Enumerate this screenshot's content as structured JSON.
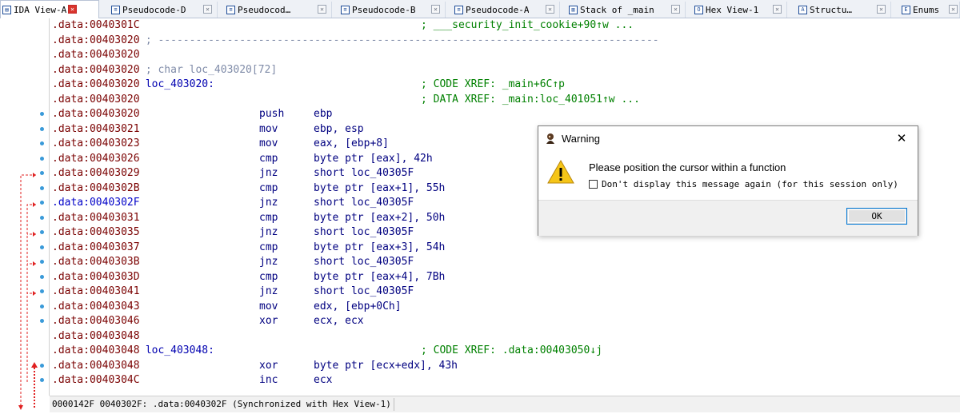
{
  "tabs": [
    {
      "label": "IDA View-A",
      "icon": "ida-view-icon",
      "active": true
    },
    {
      "label": "Pseudocode-D",
      "icon": "pseudocode-icon"
    },
    {
      "label": "Pseudocod…",
      "icon": "pseudocode-icon"
    },
    {
      "label": "Pseudocode-B",
      "icon": "pseudocode-icon"
    },
    {
      "label": "Pseudocode-A",
      "icon": "pseudocode-icon"
    },
    {
      "label": "Stack of _main",
      "icon": "stack-icon"
    },
    {
      "label": "Hex View-1",
      "icon": "hex-view-icon"
    },
    {
      "label": "Structu…",
      "icon": "structures-icon"
    },
    {
      "label": "Enums",
      "icon": "enums-icon"
    }
  ],
  "listing": [
    {
      "addr": ".data:0040301C",
      "xref": "; ___security_init_cookie+90↑w ...",
      "xref_col": 464,
      "dot": false
    },
    {
      "addr": ".data:00403020",
      "comment": " ; --------------------------------------------------------------------------------",
      "dot": false
    },
    {
      "addr": ".data:00403020",
      "dot": false
    },
    {
      "addr": ".data:00403020",
      "comment": " ; char loc_403020[72]",
      "dot": false
    },
    {
      "addr": ".data:00403020",
      "label": " loc_403020:",
      "xref": "; CODE XREF: _main+6C↑p",
      "dot": false
    },
    {
      "addr": ".data:00403020",
      "xref": "; DATA XREF: _main:loc_401051↑w ...",
      "dot": false
    },
    {
      "addr": ".data:00403020",
      "mn": "push",
      "op": "ebp",
      "dot": true
    },
    {
      "addr": ".data:00403021",
      "mn": "mov",
      "op": "ebp, esp",
      "dot": true
    },
    {
      "addr": ".data:00403023",
      "mn": "mov",
      "op": "eax, [ebp+8]",
      "dot": true
    },
    {
      "addr": ".data:00403026",
      "mn": "cmp",
      "op": "byte ptr [eax], 42h",
      "dot": true
    },
    {
      "addr": ".data:00403029",
      "mn": "jnz",
      "op": "short loc_40305F",
      "dot": true
    },
    {
      "addr": ".data:0040302B",
      "mn": "cmp",
      "op": "byte ptr [eax+1], 55h",
      "dot": true
    },
    {
      "addr": ".data:0040302F",
      "mn": "jnz",
      "op": "short loc_40305F",
      "dot": true,
      "highlight": true
    },
    {
      "addr": ".data:00403031",
      "mn": "cmp",
      "op": "byte ptr [eax+2], 50h",
      "dot": true
    },
    {
      "addr": ".data:00403035",
      "mn": "jnz",
      "op": "short loc_40305F",
      "dot": true
    },
    {
      "addr": ".data:00403037",
      "mn": "cmp",
      "op": "byte ptr [eax+3], 54h",
      "dot": true
    },
    {
      "addr": ".data:0040303B",
      "mn": "jnz",
      "op": "short loc_40305F",
      "dot": true
    },
    {
      "addr": ".data:0040303D",
      "mn": "cmp",
      "op": "byte ptr [eax+4], 7Bh",
      "dot": true
    },
    {
      "addr": ".data:00403041",
      "mn": "jnz",
      "op": "short loc_40305F",
      "dot": true
    },
    {
      "addr": ".data:00403043",
      "mn": "mov",
      "op": "edx, [ebp+0Ch]",
      "dot": true
    },
    {
      "addr": ".data:00403046",
      "mn": "xor",
      "op": "ecx, ecx",
      "dot": true
    },
    {
      "addr": ".data:00403048",
      "dot": false
    },
    {
      "addr": ".data:00403048",
      "label": " loc_403048:",
      "xref": "; CODE XREF: .data:00403050↓j",
      "dot": false
    },
    {
      "addr": ".data:00403048",
      "mn": "xor",
      "op": "byte ptr [ecx+edx], 43h",
      "dot": true
    },
    {
      "addr": ".data:0040304C",
      "mn": "inc",
      "op": "ecx",
      "dot": true
    }
  ],
  "status": {
    "text": "0000142F 0040302F: .data:0040302F (Synchronized with Hex View-1)"
  },
  "dialog": {
    "title": "Warning",
    "message": "Please position the cursor within a function",
    "checkbox_label": "Don't display this message again (for this session only)",
    "checkbox_checked": false,
    "ok_label": "OK"
  },
  "colors": {
    "address": "#7a0000",
    "address_highlight": "#0000c8",
    "comment": "#7f8ba8",
    "instruction": "#000080",
    "xref": "#008000",
    "arrow": "#e02020",
    "tab_close_active": "#d9342b"
  }
}
